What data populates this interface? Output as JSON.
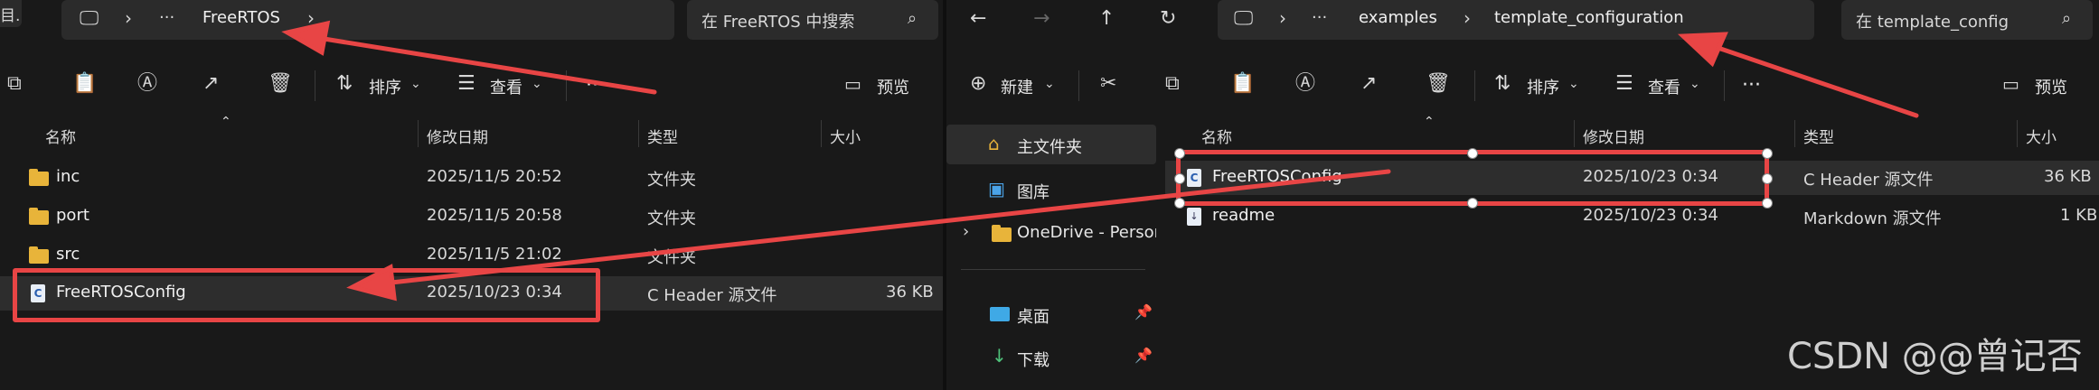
{
  "left": {
    "breadcrumb": {
      "partial": "目.",
      "more": "···",
      "folder": "FreeRTOS"
    },
    "search_placeholder": "在 FreeRTOS 中搜索",
    "toolbar": {
      "sort": "排序",
      "view": "查看",
      "more": "···",
      "preview": "预览"
    },
    "columns": [
      "名称",
      "修改日期",
      "类型",
      "大小"
    ],
    "rows": [
      {
        "name": "inc",
        "date": "2025/11/5 20:52",
        "type": "文件夹",
        "size": ""
      },
      {
        "name": "port",
        "date": "2025/11/5 20:58",
        "type": "文件夹",
        "size": ""
      },
      {
        "name": "src",
        "date": "2025/11/5 21:02",
        "type": "文件夹",
        "size": ""
      },
      {
        "name": "FreeRTOSConfig",
        "date": "2025/10/23 0:34",
        "type": "C Header 源文件",
        "size": "36 KB"
      }
    ]
  },
  "right": {
    "breadcrumb": {
      "more": "···",
      "parent": "examples",
      "folder": "template_configuration"
    },
    "search_placeholder": "在 template_config",
    "toolbar": {
      "new": "新建",
      "sort": "排序",
      "view": "查看",
      "more": "···",
      "preview": "预览"
    },
    "nav": [
      "主文件夹",
      "图库",
      "OneDrive - Person",
      "桌面",
      "下载"
    ],
    "columns": [
      "名称",
      "修改日期",
      "类型",
      "大小"
    ],
    "rows": [
      {
        "name": "FreeRTOSConfig",
        "date": "2025/10/23 0:34",
        "type": "C Header 源文件",
        "size": "36 KB"
      },
      {
        "name": "readme",
        "date": "2025/10/23 0:34",
        "type": "Markdown 源文件",
        "size": "1 KB"
      }
    ]
  },
  "watermark": "CSDN @@曾记否",
  "colors": {
    "annotation": "#e84545",
    "folder": "#e8b43a",
    "background": "#191919"
  }
}
